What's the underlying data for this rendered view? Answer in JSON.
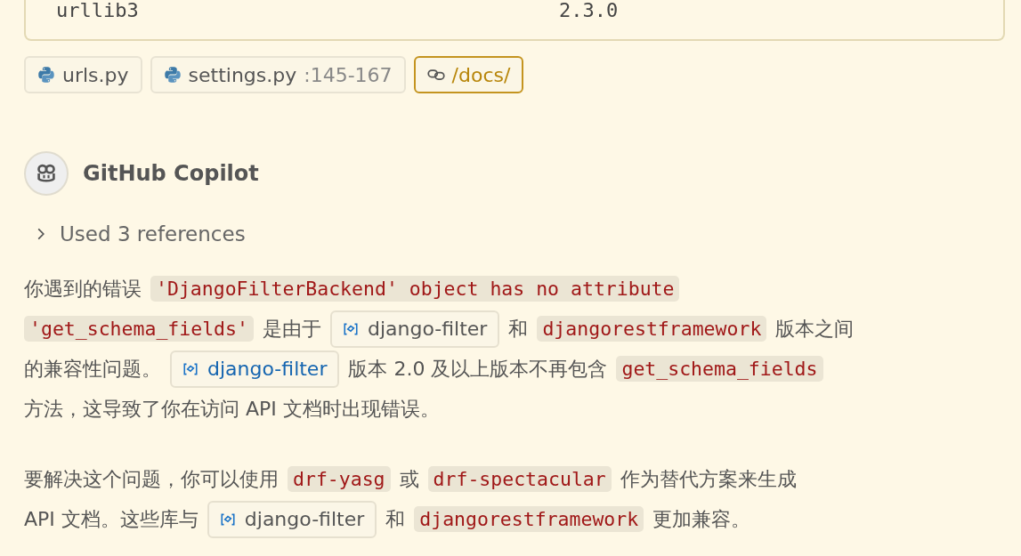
{
  "code_block": {
    "rows": [
      {
        "name": "urllib3",
        "version": "2.3.0"
      }
    ]
  },
  "references": [
    {
      "kind": "python",
      "name": "urls.py"
    },
    {
      "kind": "python",
      "name": "settings.py",
      "detail": ":145-167"
    },
    {
      "kind": "link",
      "name": "/docs/"
    }
  ],
  "assistant": {
    "name": "GitHub Copilot"
  },
  "used_references": {
    "label": "Used 3 references",
    "expanded": false
  },
  "paragraphs": [
    [
      [
        {
          "kind": "text",
          "text": "你遇到的错误"
        },
        {
          "kind": "code",
          "text": "'DjangoFilterBackend' object has no attribute"
        }
      ],
      [
        {
          "kind": "code",
          "text": "'get_schema_fields'"
        },
        {
          "kind": "text",
          "text": "是由于"
        },
        {
          "kind": "symbol",
          "text": "django-filter",
          "highlighted": false
        },
        {
          "kind": "text",
          "text": "和"
        },
        {
          "kind": "code",
          "text": "djangorestframework"
        },
        {
          "kind": "text",
          "text": "版本之间"
        }
      ],
      [
        {
          "kind": "text",
          "text": "的兼容性问题。"
        },
        {
          "kind": "symbol",
          "text": "django-filter",
          "highlighted": true
        },
        {
          "kind": "text",
          "text": "版本 2.0 及以上版本不再包含"
        },
        {
          "kind": "code",
          "text": "get_schema_fields"
        }
      ],
      [
        {
          "kind": "text",
          "text": "方法，这导致了你在访问 API 文档时出现错误。"
        }
      ]
    ],
    [
      [
        {
          "kind": "text",
          "text": "要解决这个问题，你可以使用"
        },
        {
          "kind": "code",
          "text": "drf-yasg"
        },
        {
          "kind": "text",
          "text": "或"
        },
        {
          "kind": "code",
          "text": "drf-spectacular"
        },
        {
          "kind": "text",
          "text": "作为替代方案来生成"
        }
      ],
      [
        {
          "kind": "text",
          "text": "API 文档。这些库与"
        },
        {
          "kind": "symbol",
          "text": "django-filter",
          "highlighted": false
        },
        {
          "kind": "text",
          "text": "和"
        },
        {
          "kind": "code",
          "text": "djangorestframework"
        },
        {
          "kind": "text",
          "text": "更加兼容。"
        }
      ]
    ]
  ]
}
